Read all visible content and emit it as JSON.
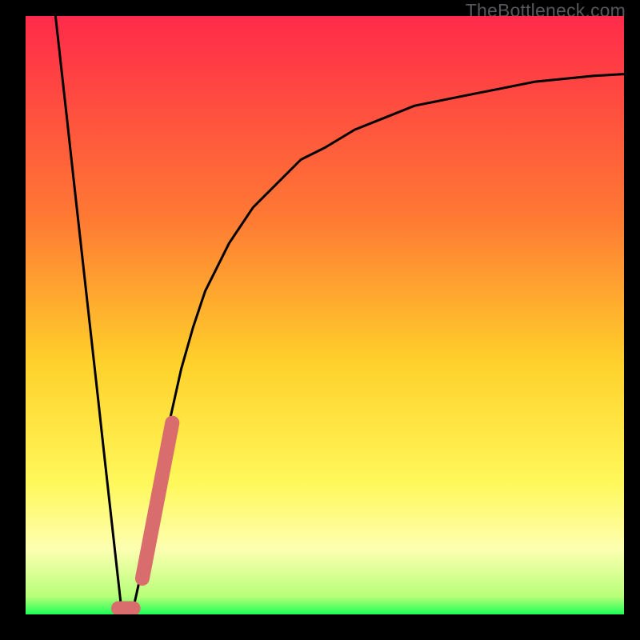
{
  "watermark": "TheBottleneck.com",
  "colors": {
    "gradient_top": "#ff2a4a",
    "gradient_mid_upper": "#ff7a33",
    "gradient_mid": "#ffd12b",
    "gradient_mid_lower": "#fff85a",
    "gradient_band": "#fdffb0",
    "gradient_bottom": "#1cff55",
    "curve": "#000000",
    "segment": "#d96c6c",
    "frame": "#000000"
  },
  "chart_data": {
    "type": "line",
    "title": "",
    "xlabel": "",
    "ylabel": "",
    "xlim": [
      0,
      100
    ],
    "ylim": [
      0,
      100
    ],
    "series": [
      {
        "name": "bottleneck-curve",
        "x": [
          5,
          6,
          7,
          8,
          9,
          10,
          11,
          12,
          13,
          14,
          15,
          16,
          18,
          20,
          22,
          24,
          26,
          28,
          30,
          34,
          38,
          42,
          46,
          50,
          55,
          60,
          65,
          70,
          75,
          80,
          85,
          90,
          95,
          100
        ],
        "y": [
          100,
          91,
          82,
          73,
          64,
          55,
          46,
          37,
          28,
          19,
          10,
          1,
          1,
          10,
          21,
          32,
          41,
          48,
          54,
          62,
          68,
          72,
          76,
          78,
          81,
          83,
          85,
          86,
          87,
          88,
          89,
          89.5,
          90,
          90.3
        ]
      },
      {
        "name": "optimal-range",
        "x": [
          16,
          17,
          23,
          24
        ],
        "y": [
          1,
          1,
          28,
          31
        ]
      }
    ]
  }
}
